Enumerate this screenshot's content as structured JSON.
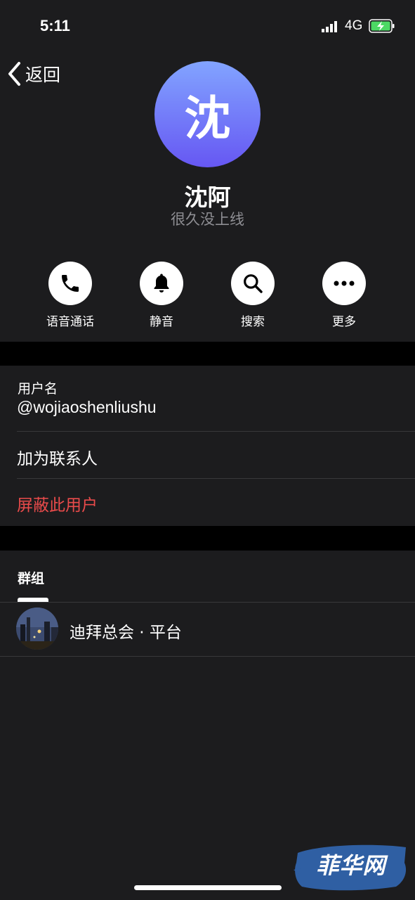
{
  "status_bar": {
    "time": "5:11",
    "network": "4G"
  },
  "nav": {
    "back_label": "返回"
  },
  "profile": {
    "avatar_initial": "沈",
    "avatar_gradient": [
      "#82a4ff",
      "#6657f3"
    ],
    "name": "沈阿",
    "status": "很久没上线"
  },
  "actions": [
    {
      "label": "语音通话",
      "icon": "phone-icon"
    },
    {
      "label": "静音",
      "icon": "bell-icon"
    },
    {
      "label": "搜索",
      "icon": "search-icon"
    },
    {
      "label": "更多",
      "icon": "more-icon"
    }
  ],
  "info": {
    "username_label": "用户名",
    "username_value": "@wojiaoshenliushu",
    "add_contact": "加为联系人",
    "block_user": "屏蔽此用户"
  },
  "groups": {
    "title": "群组",
    "items": [
      {
        "name": "迪拜总会 · 平台"
      }
    ]
  },
  "watermark": {
    "text": "菲华网"
  },
  "colors": {
    "background": "#1c1c1e",
    "separator": "#000000",
    "danger": "#ea4b4b",
    "secondary_text": "#8e8e93"
  }
}
